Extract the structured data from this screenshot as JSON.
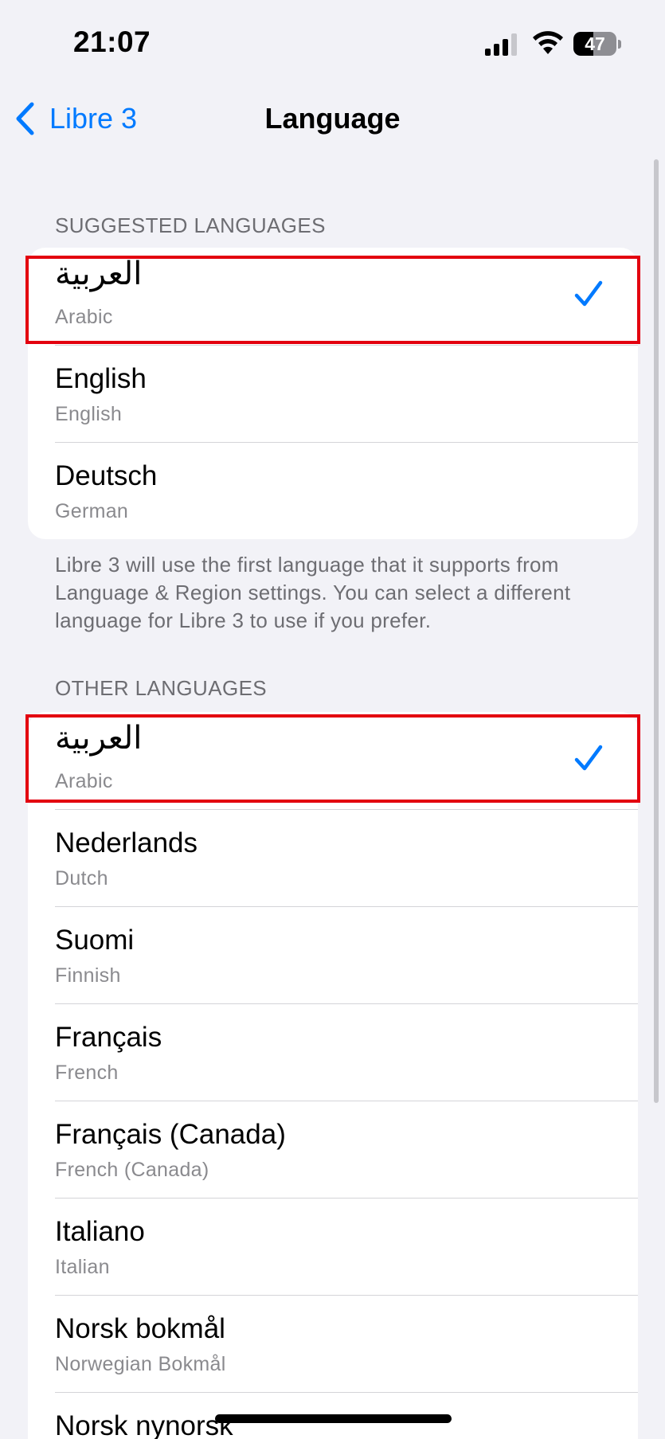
{
  "status_bar": {
    "time": "21:07",
    "battery_level": "47",
    "battery_fraction": 0.47
  },
  "nav": {
    "back_label": "Libre 3",
    "title": "Language"
  },
  "suggested": {
    "header": "SUGGESTED LANGUAGES",
    "items": [
      {
        "native": "العربية",
        "english": "Arabic",
        "selected": true
      },
      {
        "native": "English",
        "english": "English",
        "selected": false
      },
      {
        "native": "Deutsch",
        "english": "German",
        "selected": false
      }
    ],
    "footer": "Libre 3 will use the first language that it supports from Language & Region settings. You can select a different language for Libre 3 to use if you prefer."
  },
  "other": {
    "header": "OTHER LANGUAGES",
    "items": [
      {
        "native": "العربية",
        "english": "Arabic",
        "selected": true
      },
      {
        "native": "Nederlands",
        "english": "Dutch",
        "selected": false
      },
      {
        "native": "Suomi",
        "english": "Finnish",
        "selected": false
      },
      {
        "native": "Français",
        "english": "French",
        "selected": false
      },
      {
        "native": "Français (Canada)",
        "english": "French (Canada)",
        "selected": false
      },
      {
        "native": "Italiano",
        "english": "Italian",
        "selected": false
      },
      {
        "native": "Norsk bokmål",
        "english": "Norwegian Bokmål",
        "selected": false
      },
      {
        "native": "Norsk nynorsk",
        "english": "",
        "selected": false
      }
    ]
  },
  "colors": {
    "accent": "#007aff",
    "highlight": "#e3000f",
    "background": "#f2f2f7"
  }
}
